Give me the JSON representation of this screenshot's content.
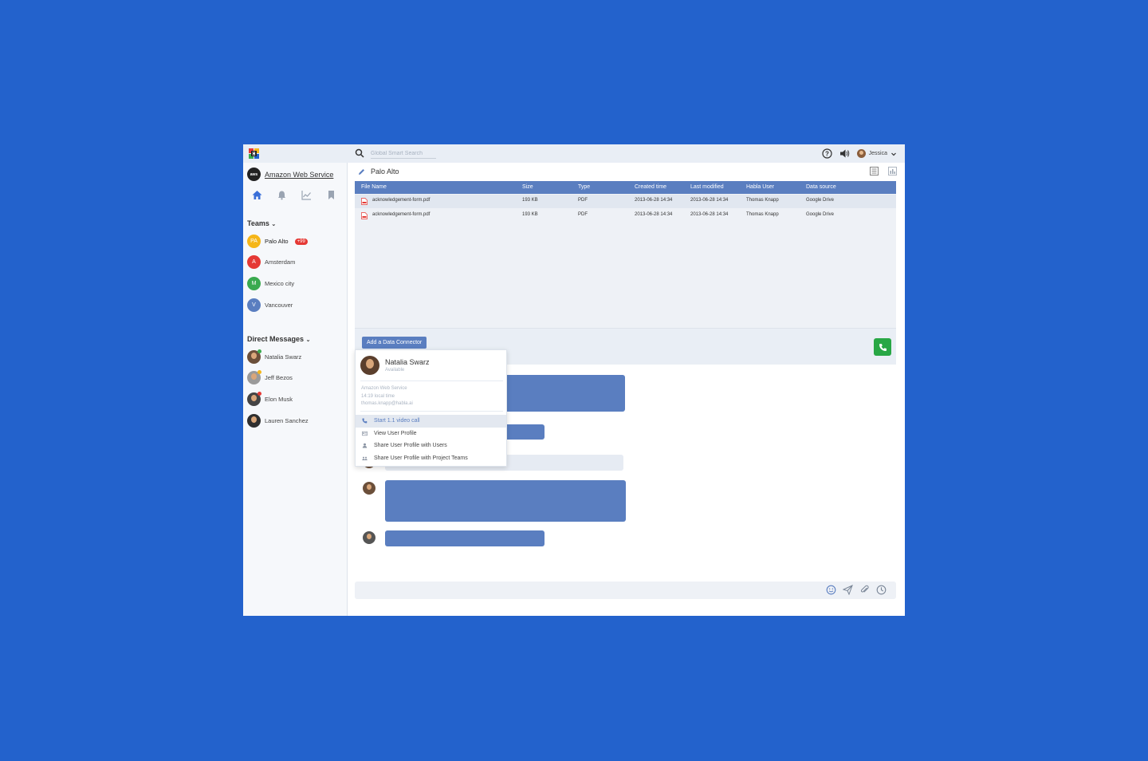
{
  "topbar": {
    "search_placeholder": "Global Smart Search",
    "user_name": "Jessica"
  },
  "sidebar": {
    "org_logo_text": "aws",
    "org_name": "Amazon Web Service",
    "teams_title": "Teams",
    "teams": [
      {
        "initials": "PA",
        "name": "Palo Alto",
        "color": "#f5b619",
        "badge": "+99"
      },
      {
        "initials": "A",
        "name": "Amsterdam",
        "color": "#e53935"
      },
      {
        "initials": "M",
        "name": "Mexico city",
        "color": "#3aaa4f"
      },
      {
        "initials": "V",
        "name": "Vancouver",
        "color": "#5a7ec0"
      }
    ],
    "dm_title": "Direct Messages",
    "dms": [
      {
        "name": "Natalia Swarz",
        "status_color": "#3aaa4f"
      },
      {
        "name": "Jeff Bezos",
        "status_color": "#f5b619"
      },
      {
        "name": "Elon Musk",
        "status_color": "#e53935"
      },
      {
        "name": "Lauren Sanchez",
        "status_color": ""
      }
    ]
  },
  "main": {
    "title": "Palo Alto",
    "table": {
      "headers": [
        "File Name",
        "Size",
        "Type",
        "Created time",
        "Last modified",
        "Habla User",
        "Data source"
      ],
      "rows": [
        [
          "acknowledgement-form.pdf",
          "193 KB",
          "PDF",
          "2013-06-28 14:34",
          "2013-06-28 14:34",
          "Thomas Knapp",
          "Google Drive"
        ],
        [
          "acknowledgement-form.pdf",
          "193 KB",
          "PDF",
          "2013-06-28 14:34",
          "2013-06-28 14:34",
          "Thomas Knapp",
          "Google Drive"
        ]
      ]
    },
    "add_connector_label": "Add a Data Connector"
  },
  "popup": {
    "name": "Natalia Swarz",
    "status": "Available",
    "org": "Amazon Web Service",
    "local_time": "14:19 local time",
    "email": "thomas.knapp@habla.ai",
    "menu": [
      "Start 1.1 video call",
      "View User Profile",
      "Share User Profile with Users",
      "Share User Profile with Project Teams"
    ]
  },
  "colors": {
    "background": "#2362cc",
    "accent": "#5a7ec0",
    "call_green": "#28a745"
  }
}
